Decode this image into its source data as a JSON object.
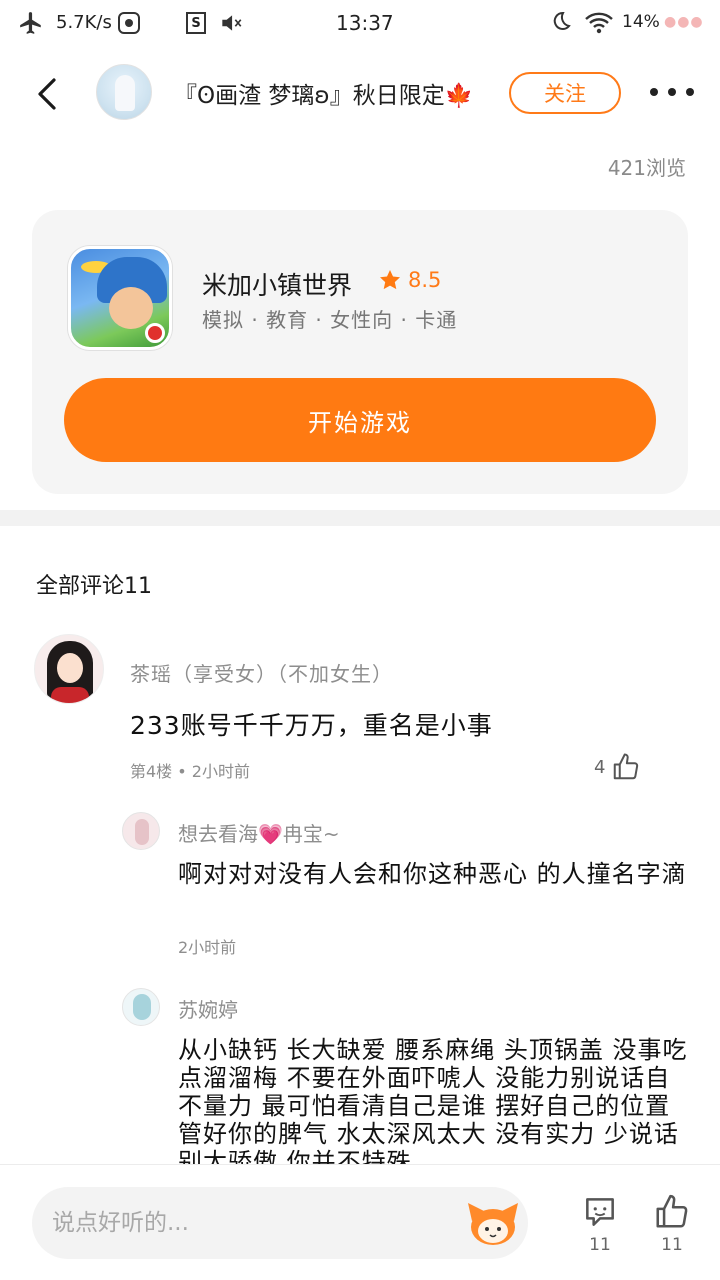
{
  "status_bar": {
    "network_speed": "5.7K/s",
    "time": "13:37",
    "battery": "14%"
  },
  "header": {
    "title": "『ʘ画渣  梦璃ʚ』秋日限定🍁",
    "follow_label": "关注"
  },
  "views": "421浏览",
  "game": {
    "name": "米加小镇世界",
    "rating": "8.5",
    "tags": "模拟 · 教育 · 女性向 · 卡通",
    "play_label": "开始游戏"
  },
  "comments_section": {
    "title": "全部评论11",
    "main_comment": {
      "author": "茶瑶（享受女）（不加女生）",
      "text": "233账号千千万万，重名是小事",
      "meta": "第4楼 • 2小时前",
      "likes": "4"
    },
    "replies": [
      {
        "author": "想去看海💗冉宝~",
        "text": "啊对对对没有人会和你这种恶心  的人撞名字滴",
        "time": "2小时前"
      },
      {
        "author": "苏婉婷",
        "text": "从小缺钙 长大缺爱 腰系麻绳 头顶锅盖 没事吃点溜溜梅 不要在外面吓唬人 没能力别说话自不量力 最可怕看清自己是谁 摆好自己的位置 管好你的脾气 水太深风太大 没有实力 少说话 别太骄傲 你并不特殊"
      }
    ]
  },
  "bottom_bar": {
    "input_placeholder": "说点好听的...",
    "comment_count": "11",
    "like_count": "11"
  },
  "colors": {
    "accent": "#ff7a12",
    "card_bg": "#f5f5f5",
    "muted_text": "#8e8e8e"
  }
}
